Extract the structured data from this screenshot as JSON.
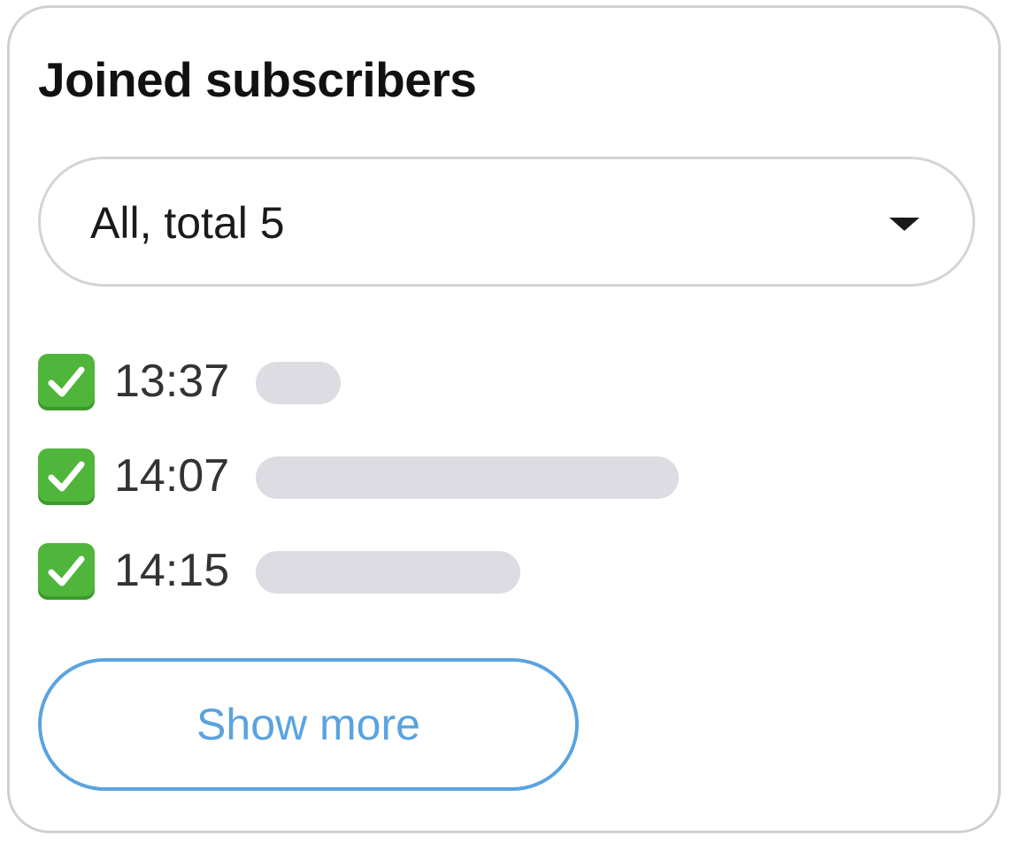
{
  "card": {
    "title": "Joined subscribers"
  },
  "filter": {
    "selected": "All, total 5",
    "caret_icon": "caret-down-icon"
  },
  "subscribers": [
    {
      "status_icon": "check-mark-button-icon",
      "time": "13:37"
    },
    {
      "status_icon": "check-mark-button-icon",
      "time": "14:07"
    },
    {
      "status_icon": "check-mark-button-icon",
      "time": "14:15"
    }
  ],
  "actions": {
    "show_more_label": "Show more"
  },
  "colors": {
    "accent": "#5aa3e0",
    "check_green": "#4fb53b",
    "placeholder": "#dcdce2",
    "border": "#d0d0d0"
  }
}
